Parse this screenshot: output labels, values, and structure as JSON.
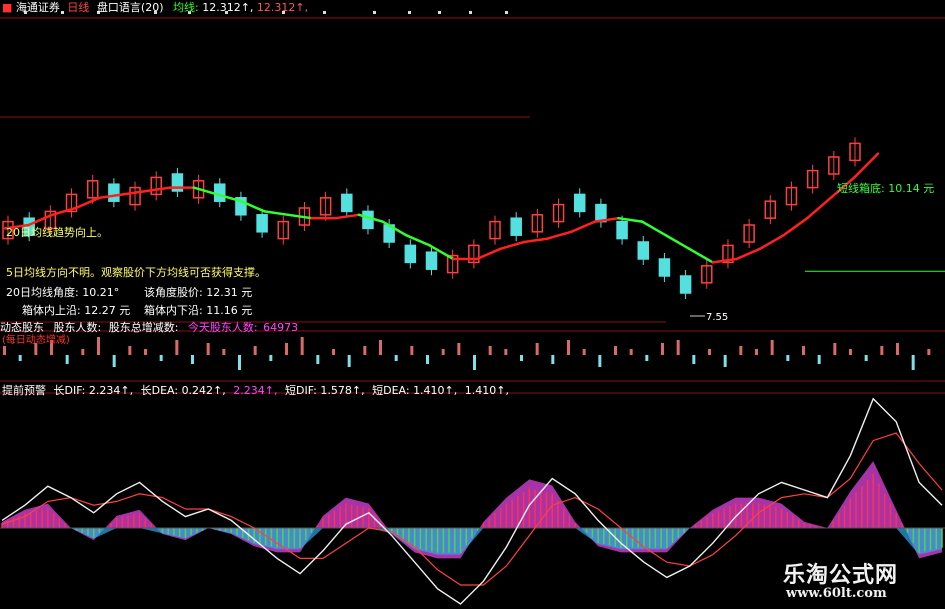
{
  "header": {
    "broker": "海通证券",
    "period": "日线",
    "formula": "盘口语言(20)",
    "ma_label": "均线:",
    "ma_value": "12.312↑,",
    "ma_value2": "12.312↑,"
  },
  "main_panel": {
    "notes": [
      {
        "text": "20日均线趋势向上。",
        "color": "#ffff66"
      },
      {
        "text": "5日均线方向不明。观察股价下方均线可否获得支撑。",
        "color": "#ffff66"
      },
      {
        "text": "20日均线角度:  10.21°",
        "color": "#ffffff"
      },
      {
        "text": "该角度股价:  12.31 元",
        "color": "#ffffff"
      },
      {
        "text": "箱体内上沿:  12.27 元",
        "color": "#ffffff"
      },
      {
        "text": "箱体内下沿:  11.16 元",
        "color": "#ffffff"
      }
    ],
    "box_label": "短线箱底:  10.14 元",
    "low_marker": "7.55"
  },
  "holders_panel": {
    "title": "动态股东",
    "items": [
      {
        "text": "股东人数:",
        "color": "#ffffff"
      },
      {
        "text": "股东总增减数:",
        "color": "#ffffff"
      },
      {
        "text": "今天股东人数:",
        "color": "#ff44ff"
      },
      {
        "text": "64973",
        "color": "#ff44ff"
      }
    ],
    "subtitle": "(每日动态增减)"
  },
  "macd_panel": {
    "title": "提前预警",
    "items": [
      {
        "text": "长DIF:  2.234↑,",
        "color": "#ffffff"
      },
      {
        "text": "长DEA:  0.242↑,",
        "color": "#ffffff"
      },
      {
        "text": "2.234↑,",
        "color": "#ff44ff"
      },
      {
        "text": "短DIF:  1.578↑,",
        "color": "#ffffff"
      },
      {
        "text": "短DEA:  1.410↑,",
        "color": "#ffffff"
      },
      {
        "text": "1.410↑,",
        "color": "#ffffff"
      }
    ]
  },
  "watermark": {
    "name": "乐淘公式网",
    "url": "www.60lt.com"
  },
  "chart_data": {
    "type": "line",
    "price_line": {
      "x": [
        0,
        5,
        10,
        15,
        20,
        25,
        30,
        35,
        40,
        45,
        50,
        55,
        60,
        65,
        70,
        75,
        80,
        85,
        90,
        95,
        100,
        105,
        110,
        115,
        120,
        125,
        130,
        135,
        140,
        145,
        150,
        155,
        160,
        165,
        170,
        175,
        180,
        185
      ],
      "y": [
        11.4,
        11.5,
        11.8,
        12.0,
        12.3,
        12.4,
        12.5,
        12.6,
        12.6,
        12.4,
        12.2,
        11.9,
        11.8,
        11.7,
        11.7,
        11.8,
        11.6,
        11.2,
        10.9,
        10.5,
        10.5,
        10.8,
        11.0,
        11.1,
        11.3,
        11.6,
        11.7,
        11.6,
        11.2,
        10.8,
        10.4,
        10.5,
        10.8,
        11.2,
        11.7,
        12.3,
        12.9,
        13.6
      ]
    },
    "candles": {
      "close": [
        11.6,
        11.2,
        11.9,
        12.4,
        12.8,
        12.2,
        12.6,
        12.9,
        12.5,
        12.8,
        12.2,
        11.8,
        11.3,
        11.6,
        12.0,
        12.3,
        11.9,
        11.4,
        11.0,
        10.4,
        10.2,
        10.6,
        10.9,
        11.6,
        11.2,
        11.8,
        12.1,
        11.9,
        11.6,
        11.1,
        10.5,
        10.0,
        9.5,
        10.3,
        10.9,
        11.5,
        12.2,
        12.6,
        13.1,
        13.5,
        13.9
      ],
      "up": [
        true,
        false,
        true,
        true,
        true,
        false,
        true,
        true,
        false,
        true,
        false,
        false,
        false,
        true,
        true,
        true,
        false,
        false,
        false,
        false,
        false,
        true,
        true,
        true,
        false,
        true,
        true,
        false,
        false,
        false,
        false,
        false,
        false,
        true,
        true,
        true,
        true,
        true,
        true,
        true,
        true
      ]
    },
    "ma_level": 12.312,
    "box_bottom": 10.14,
    "low": 7.55,
    "holders_bars": [
      3,
      -2,
      4,
      5,
      -3,
      2,
      6,
      -4,
      3,
      2,
      -2,
      5,
      -3,
      4,
      2,
      -5,
      3,
      -2,
      4,
      6,
      -3,
      2,
      -4,
      3,
      5,
      -2,
      3,
      -3,
      2,
      4,
      -5,
      3,
      2,
      -2,
      4,
      -3,
      5,
      2,
      -4,
      3,
      2,
      -2,
      4,
      5,
      -3,
      2,
      -4,
      3,
      2,
      5,
      -2,
      3,
      -3,
      4,
      2,
      -2,
      3,
      4,
      -5,
      2
    ],
    "macd": {
      "dif": [
        0.2,
        0.6,
        1.1,
        0.8,
        0.4,
        0.9,
        1.2,
        0.7,
        0.3,
        0.5,
        0.2,
        -0.3,
        -0.8,
        -1.2,
        -0.6,
        0.1,
        0.4,
        -0.2,
        -0.9,
        -1.6,
        -2.0,
        -1.4,
        -0.5,
        0.6,
        1.3,
        0.9,
        0.2,
        -0.4,
        -0.9,
        -1.3,
        -1.0,
        -0.4,
        0.3,
        0.9,
        1.2,
        1.0,
        0.8,
        1.9,
        3.4,
        2.8,
        1.2,
        0.6
      ],
      "dea": [
        0.1,
        0.3,
        0.7,
        0.8,
        0.6,
        0.7,
        0.9,
        0.8,
        0.5,
        0.5,
        0.3,
        0.0,
        -0.4,
        -0.8,
        -0.8,
        -0.4,
        0.0,
        -0.1,
        -0.5,
        -1.1,
        -1.5,
        -1.5,
        -1.0,
        -0.2,
        0.6,
        0.8,
        0.5,
        0.0,
        -0.5,
        -0.9,
        -1.0,
        -0.7,
        -0.2,
        0.4,
        0.8,
        0.9,
        0.8,
        1.3,
        2.3,
        2.5,
        1.7,
        1.0
      ],
      "hist": [
        0.1,
        0.3,
        0.4,
        0.0,
        -0.2,
        0.2,
        0.3,
        -0.1,
        -0.2,
        0.0,
        -0.1,
        -0.3,
        -0.4,
        -0.4,
        0.2,
        0.5,
        0.4,
        -0.1,
        -0.4,
        -0.5,
        -0.5,
        0.1,
        0.5,
        0.8,
        0.7,
        0.1,
        -0.3,
        -0.4,
        -0.4,
        -0.4,
        0.0,
        0.3,
        0.5,
        0.5,
        0.4,
        0.1,
        0.0,
        0.6,
        1.1,
        0.3,
        -0.5,
        -0.4
      ]
    }
  }
}
